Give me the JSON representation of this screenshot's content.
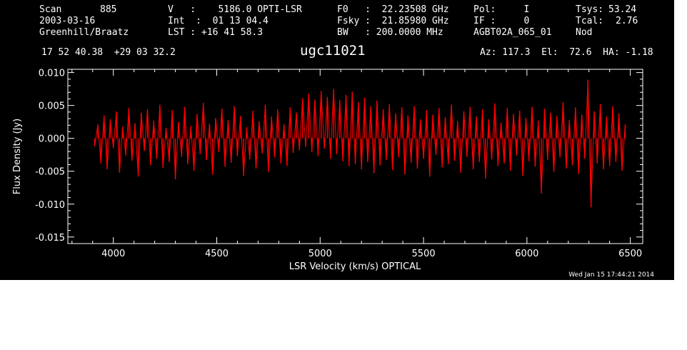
{
  "header": {
    "col1": {
      "scan_label": "Scan",
      "scan_value": "885",
      "date": "2003-03-16",
      "observer": "Greenhill/Braatz"
    },
    "col2": {
      "v_line": "V   :    5186.0 OPTI-LSR",
      "int_line": "Int  :  01 13 04.4",
      "lst_line": "LST : +16 41 58.3"
    },
    "col3": {
      "f0_line": "F0   :  22.23508 GHz",
      "fsky_line": "Fsky :  21.85980 GHz",
      "bw_line": "BW   : 200.0000 MHz"
    },
    "col4": {
      "pol_line": "Pol:     I",
      "if_line": "IF :     0",
      "proj_line": "AGBT02A_065_01"
    },
    "col5": {
      "tsys_label": "Tsys:",
      "tsys_value": "53.24",
      "tcal_label": "Tcal:",
      "tcal_value": "2.76",
      "mode": "Nod"
    },
    "coords": "17 52 40.38  +29 03 32.2",
    "source": "ugc11021",
    "pointing": "Az: 117.3  El:  72.6  HA: -1.18"
  },
  "timestamp": "Wed Jan 15 17:44:21 2014",
  "colors": {
    "background": "#000000",
    "axes": "#ffffff",
    "trace": "#ff0000"
  },
  "chart_data": {
    "type": "line",
    "xlabel": "LSR Velocity (km/s) OPTICAL",
    "ylabel": "Flux Density (Jy)",
    "xlim": [
      3780,
      6560
    ],
    "ylim": [
      -0.016,
      0.0105
    ],
    "xticks": [
      {
        "value": 4000,
        "label": "4000"
      },
      {
        "value": 4500,
        "label": "4500"
      },
      {
        "value": 5000,
        "label": "5000"
      },
      {
        "value": 5500,
        "label": "5500"
      },
      {
        "value": 6000,
        "label": "6000"
      },
      {
        "value": 6500,
        "label": "6500"
      }
    ],
    "yticks": [
      {
        "value": 0.01,
        "label": "0.010"
      },
      {
        "value": 0.005,
        "label": "0.005"
      },
      {
        "value": 0.0,
        "label": "0.000"
      },
      {
        "value": -0.005,
        "label": "-0.005"
      },
      {
        "value": -0.01,
        "label": "-0.010"
      },
      {
        "value": -0.015,
        "label": "-0.015"
      }
    ],
    "series": [
      {
        "color": "#ff0000",
        "x": [
          3910,
          3925,
          3940,
          3955,
          3970,
          3985,
          4000,
          4015,
          4030,
          4045,
          4060,
          4075,
          4090,
          4105,
          4120,
          4135,
          4150,
          4165,
          4180,
          4195,
          4210,
          4225,
          4240,
          4255,
          4270,
          4285,
          4300,
          4315,
          4330,
          4345,
          4360,
          4375,
          4390,
          4405,
          4420,
          4435,
          4450,
          4465,
          4480,
          4495,
          4510,
          4525,
          4540,
          4555,
          4570,
          4585,
          4600,
          4615,
          4630,
          4645,
          4660,
          4675,
          4690,
          4705,
          4720,
          4735,
          4750,
          4765,
          4780,
          4795,
          4810,
          4825,
          4840,
          4855,
          4870,
          4885,
          4900,
          4915,
          4930,
          4945,
          4960,
          4975,
          4990,
          5005,
          5020,
          5035,
          5050,
          5065,
          5080,
          5095,
          5110,
          5125,
          5140,
          5155,
          5170,
          5185,
          5200,
          5215,
          5230,
          5245,
          5260,
          5275,
          5290,
          5305,
          5320,
          5335,
          5350,
          5365,
          5380,
          5395,
          5410,
          5425,
          5440,
          5455,
          5470,
          5485,
          5500,
          5515,
          5530,
          5545,
          5560,
          5575,
          5590,
          5605,
          5620,
          5635,
          5650,
          5665,
          5680,
          5695,
          5710,
          5725,
          5740,
          5755,
          5770,
          5785,
          5800,
          5815,
          5830,
          5845,
          5860,
          5875,
          5890,
          5905,
          5920,
          5935,
          5950,
          5965,
          5980,
          5995,
          6010,
          6025,
          6040,
          6055,
          6070,
          6085,
          6100,
          6115,
          6130,
          6145,
          6160,
          6175,
          6190,
          6205,
          6220,
          6235,
          6250,
          6265,
          6280,
          6295,
          6310,
          6325,
          6340,
          6355,
          6370,
          6385,
          6400,
          6415,
          6430,
          6445,
          6460,
          6475
        ],
        "y": [
          -0.0012,
          0.0021,
          -0.0038,
          0.0035,
          -0.0047,
          0.0029,
          -0.0015,
          0.0041,
          -0.0052,
          0.0018,
          -0.0026,
          0.0046,
          -0.0034,
          0.0023,
          -0.0058,
          0.0039,
          -0.0019,
          0.0044,
          -0.0041,
          0.0027,
          -0.0031,
          0.0051,
          -0.0045,
          0.0016,
          -0.0036,
          0.0043,
          -0.0062,
          0.0025,
          -0.0028,
          0.0048,
          -0.0039,
          0.0019,
          -0.0049,
          0.0037,
          -0.0024,
          0.0054,
          -0.0033,
          0.0022,
          -0.0055,
          0.0031,
          -0.0021,
          0.0045,
          -0.0043,
          0.0028,
          -0.0037,
          0.0049,
          -0.0027,
          0.0034,
          -0.0057,
          0.0017,
          -0.0032,
          0.0042,
          -0.0046,
          0.0026,
          -0.0023,
          0.0051,
          -0.0051,
          0.0033,
          -0.0029,
          0.0044,
          -0.0038,
          0.0021,
          -0.0042,
          0.0047,
          -0.0022,
          0.0039,
          -0.0018,
          0.0061,
          -0.0013,
          0.0068,
          -0.0021,
          0.0059,
          -0.0027,
          0.0072,
          -0.0016,
          0.0063,
          -0.0031,
          0.0075,
          -0.0024,
          0.0058,
          -0.0035,
          0.0066,
          -0.0042,
          0.0071,
          -0.0039,
          0.0055,
          -0.0047,
          0.0062,
          -0.0036,
          0.0049,
          -0.0053,
          0.0057,
          -0.0041,
          0.0044,
          -0.0033,
          0.0052,
          -0.0048,
          0.0038,
          -0.0029,
          0.0047,
          -0.0055,
          0.0035,
          -0.0037,
          0.0049,
          -0.0046,
          0.0029,
          -0.0031,
          0.0043,
          -0.0058,
          0.0036,
          -0.0025,
          0.0046,
          -0.0044,
          0.0032,
          -0.0039,
          0.0051,
          -0.0034,
          0.0026,
          -0.0052,
          0.0041,
          -0.0028,
          0.0048,
          -0.0047,
          0.0033,
          -0.0036,
          0.0044,
          -0.0061,
          0.0029,
          -0.0032,
          0.0053,
          -0.0042,
          0.0024,
          -0.0038,
          0.0046,
          -0.0049,
          0.0037,
          -0.0026,
          0.0042,
          -0.0057,
          0.0031,
          -0.0035,
          0.0048,
          -0.0043,
          0.0027,
          -0.0084,
          0.0045,
          -0.0033,
          0.0039,
          -0.0051,
          0.0034,
          -0.0029,
          0.0055,
          -0.0046,
          0.0028,
          -0.0041,
          0.0047,
          -0.0054,
          0.0036,
          -0.0031,
          0.0089,
          -0.0105,
          0.0041,
          -0.0038,
          0.0052,
          -0.0047,
          0.0033,
          -0.0042,
          0.0049,
          -0.0036,
          0.0038,
          -0.0049,
          0.0021
        ]
      }
    ]
  }
}
